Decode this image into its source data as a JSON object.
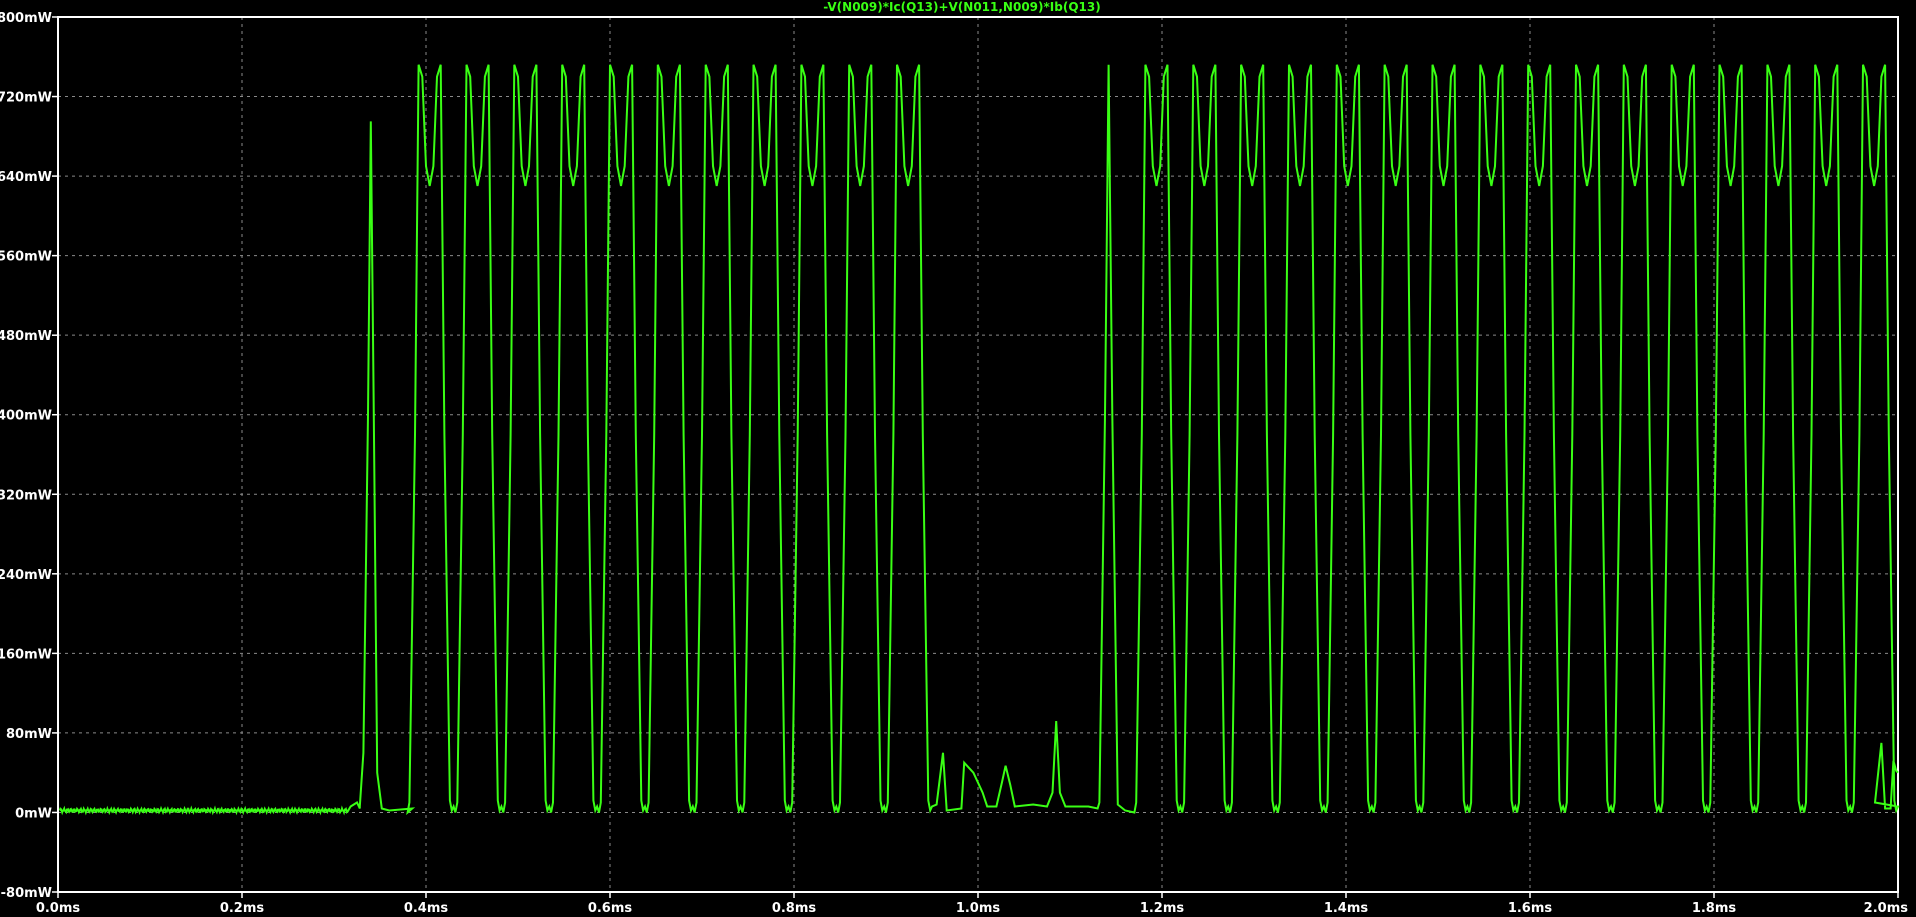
{
  "chart_data": {
    "type": "line",
    "title": "-V(N009)*Ic(Q13)+V(N011,N009)*Ib(Q13)",
    "xlabel": "",
    "ylabel": "",
    "xlim": [
      0.0,
      2.0
    ],
    "ylim": [
      -80,
      800
    ],
    "x_unit": "ms",
    "y_unit": "mW",
    "grid": true,
    "x_ticks": [
      "0.0ms",
      "0.2ms",
      "0.4ms",
      "0.6ms",
      "0.8ms",
      "1.0ms",
      "1.2ms",
      "1.4ms",
      "1.6ms",
      "1.8ms",
      "2.0ms"
    ],
    "x_tick_values": [
      0.0,
      0.2,
      0.4,
      0.6,
      0.8,
      1.0,
      1.2,
      1.4,
      1.6,
      1.8,
      2.0
    ],
    "y_ticks": [
      "-80mW",
      "0mW",
      "80mW",
      "160mW",
      "240mW",
      "320mW",
      "400mW",
      "480mW",
      "560mW",
      "640mW",
      "720mW",
      "800mW"
    ],
    "y_tick_values": [
      -80,
      0,
      80,
      160,
      240,
      320,
      400,
      480,
      560,
      640,
      720,
      800
    ],
    "series": [
      {
        "color": "#39ff14",
        "idle_level": 2,
        "first_spike": {
          "x": 0.34,
          "peak": 695
        },
        "pulse_period": 0.052,
        "pulse_peak": 752,
        "pulse_dip": 630,
        "burst1": {
          "start": 0.392,
          "end": 0.98
        },
        "gap_bumps": [
          {
            "x": 0.985,
            "peak": 50
          },
          {
            "x": 1.03,
            "peak": 47
          },
          {
            "x": 1.085,
            "peak": 92
          }
        ],
        "burst2": {
          "start": 1.14,
          "end": 1.985
        },
        "tail": {
          "x": 1.995,
          "level": 52
        }
      }
    ]
  }
}
